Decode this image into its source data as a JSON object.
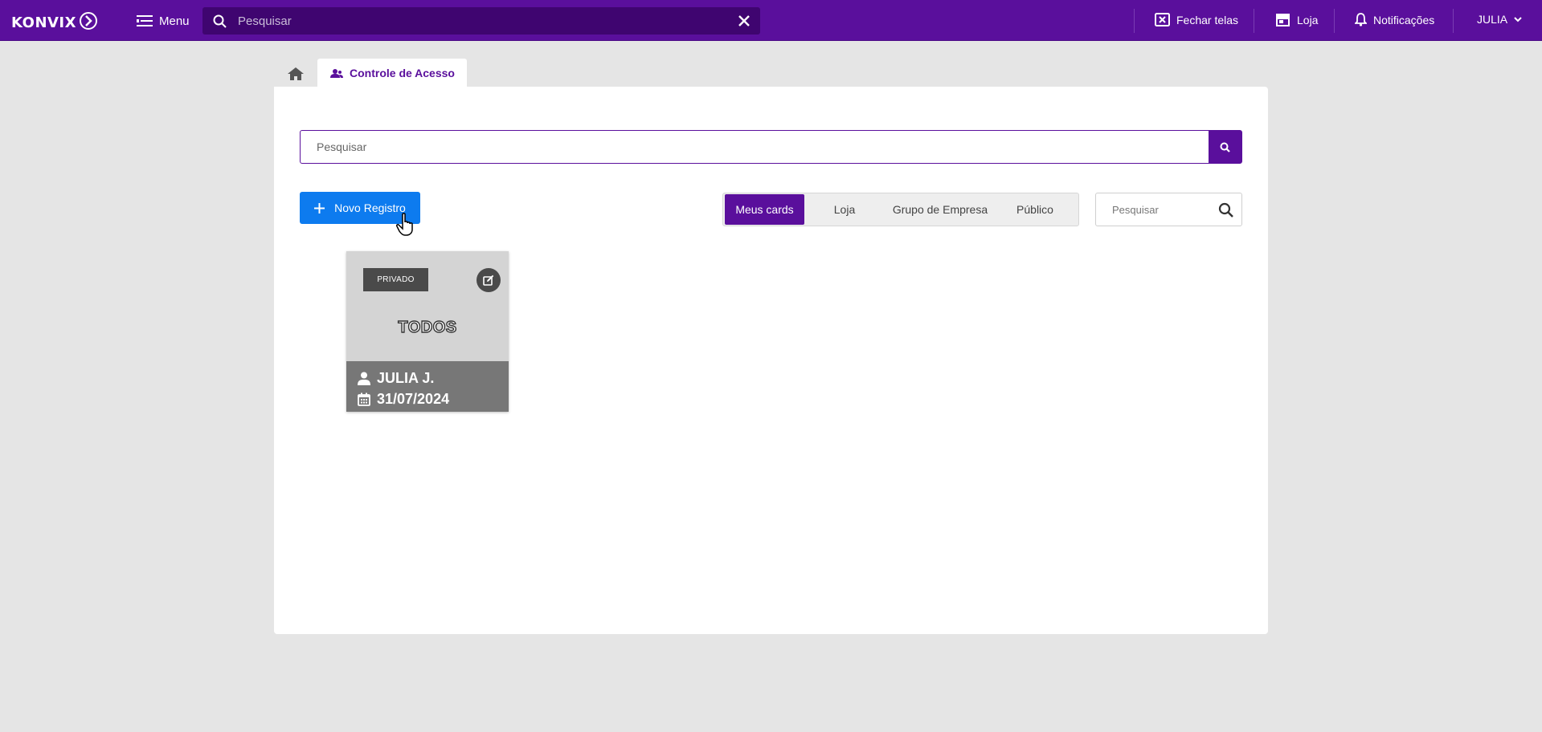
{
  "app": {
    "logo_text": "KONVIX",
    "menu_label": "Menu",
    "search_placeholder": "Pesquisar",
    "brand_color": "#5a0f9c"
  },
  "topbar": {
    "close_screens_label": "Fechar telas",
    "store_label": "Loja",
    "notifications_label": "Notificações",
    "user_label": "JULIA"
  },
  "tabs": {
    "home_icon": "home-icon",
    "active_label": "Controle de Acesso"
  },
  "main": {
    "search_placeholder": "Pesquisar",
    "new_button_label": "Novo Registro",
    "filters": [
      "Meus cards",
      "Loja",
      "Grupo de Empresa",
      "Público"
    ],
    "active_filter": "Meus cards",
    "side_search_placeholder": "Pesquisar"
  },
  "card": {
    "badge": "PRIVADO",
    "title": "TODOS",
    "user": "JULIA J.",
    "date": "31/07/2024"
  }
}
